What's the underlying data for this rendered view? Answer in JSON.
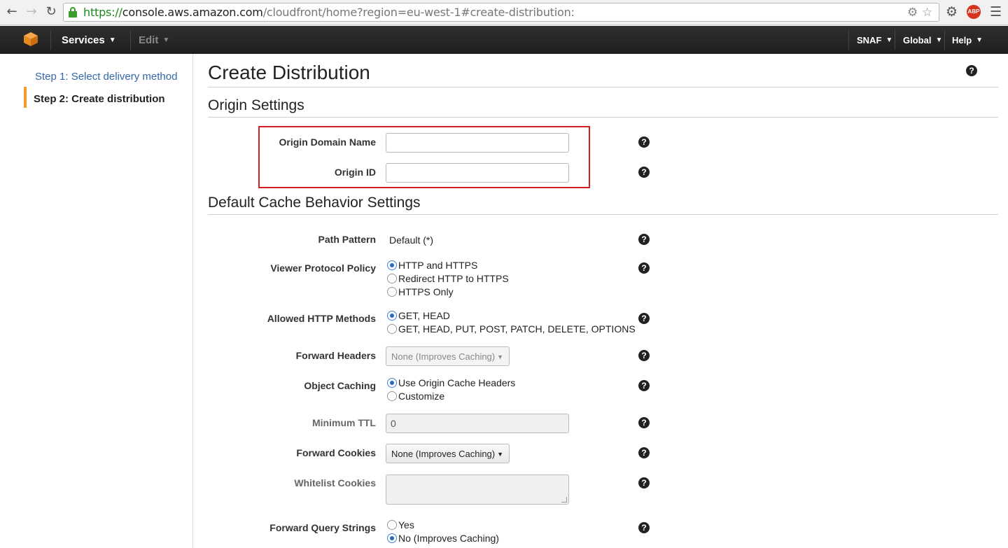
{
  "browser": {
    "url_protocol": "https://",
    "url_host": "console.aws.amazon.com",
    "url_path": "/cloudfront/home?region=eu-west-1#create-distribution:"
  },
  "nav": {
    "services": "Services",
    "edit": "Edit",
    "account": "SNAF",
    "region": "Global",
    "help": "Help"
  },
  "sidebar": {
    "steps": [
      {
        "label": "Step 1: Select delivery method",
        "active": false
      },
      {
        "label": "Step 2: Create distribution",
        "active": true
      }
    ]
  },
  "page": {
    "title": "Create Distribution"
  },
  "origin_settings": {
    "heading": "Origin Settings",
    "origin_domain_name": {
      "label": "Origin Domain Name",
      "value": ""
    },
    "origin_id": {
      "label": "Origin ID",
      "value": ""
    }
  },
  "cache_behavior": {
    "heading": "Default Cache Behavior Settings",
    "path_pattern": {
      "label": "Path Pattern",
      "value": "Default (*)"
    },
    "viewer_protocol_policy": {
      "label": "Viewer Protocol Policy",
      "options": [
        "HTTP and HTTPS",
        "Redirect HTTP to HTTPS",
        "HTTPS Only"
      ],
      "selected": "HTTP and HTTPS"
    },
    "allowed_http_methods": {
      "label": "Allowed HTTP Methods",
      "options": [
        "GET, HEAD",
        "GET, HEAD, PUT, POST, PATCH, DELETE, OPTIONS"
      ],
      "selected": "GET, HEAD"
    },
    "forward_headers": {
      "label": "Forward Headers",
      "value": "None (Improves Caching)"
    },
    "object_caching": {
      "label": "Object Caching",
      "options": [
        "Use Origin Cache Headers",
        "Customize"
      ],
      "selected": "Use Origin Cache Headers"
    },
    "minimum_ttl": {
      "label": "Minimum TTL",
      "value": "0"
    },
    "forward_cookies": {
      "label": "Forward Cookies",
      "value": "None (Improves Caching)"
    },
    "whitelist_cookies": {
      "label": "Whitelist Cookies",
      "value": ""
    },
    "forward_query_strings": {
      "label": "Forward Query Strings",
      "options": [
        "Yes",
        "No (Improves Caching)"
      ],
      "selected": "No (Improves Caching)"
    }
  },
  "colors": {
    "highlight_border": "#d21f26",
    "active_step_marker": "#f19d2c",
    "link": "#3366aa",
    "nav_background": "#232323"
  }
}
